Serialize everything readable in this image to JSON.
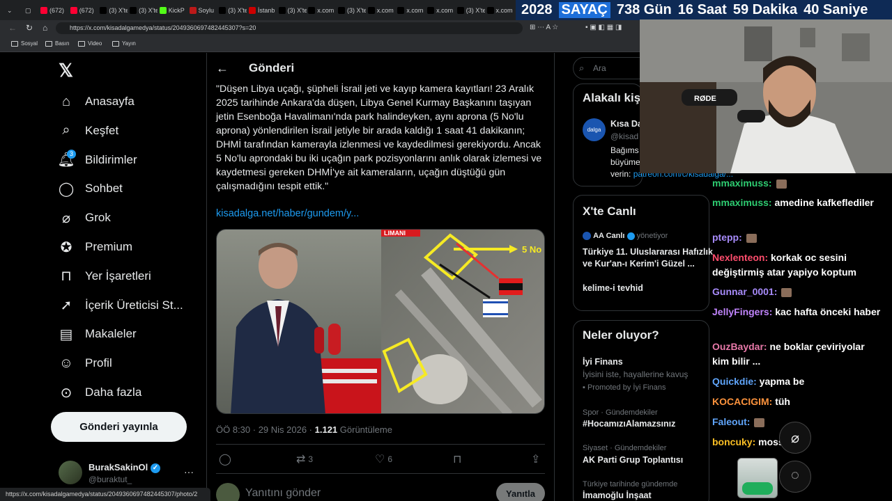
{
  "browser": {
    "tabs": [
      {
        "label": "(672)",
        "icon": "youtube-icon"
      },
      {
        "label": "(672)",
        "icon": "youtube-icon"
      },
      {
        "label": "(3) X'te",
        "icon": "x-icon"
      },
      {
        "label": "(3) X'te",
        "icon": "x-icon"
      },
      {
        "label": "KickP",
        "icon": "kick-icon"
      },
      {
        "label": "Soylu",
        "icon": "bbc-icon"
      },
      {
        "label": "(3) X'te",
        "icon": "x-icon"
      },
      {
        "label": "İstanb",
        "icon": "news-icon"
      },
      {
        "label": "(3) X'te",
        "icon": "x-icon"
      },
      {
        "label": "x.com",
        "icon": "x-icon"
      },
      {
        "label": "(3) X'te",
        "icon": "x-icon"
      },
      {
        "label": "x.com",
        "icon": "x-icon"
      },
      {
        "label": "x.com",
        "icon": "x-icon"
      },
      {
        "label": "x.com",
        "icon": "x-icon"
      },
      {
        "label": "(3) X'te",
        "icon": "x-icon"
      },
      {
        "label": "x.com",
        "icon": "x-icon"
      }
    ],
    "url": "https://x.com/kisadalgamedya/status/2049360697482445307?s=20",
    "bookmarks": [
      "Sosyal",
      "Basın",
      "Video",
      "Yayın"
    ],
    "status_url": "https://x.com/kisadalgamedya/status/2049360697482445307/photo/2"
  },
  "counter": {
    "year": "2028",
    "label": "SAYAÇ",
    "days": "738 Gün",
    "hours": "16 Saat",
    "minutes": "59 Dakika",
    "seconds": "40 Saniye"
  },
  "sidebar": {
    "items": [
      {
        "label": "Anasayfa",
        "icon": "home-icon"
      },
      {
        "label": "Keşfet",
        "icon": "search-icon"
      },
      {
        "label": "Bildirimler",
        "icon": "bell-icon",
        "badge": "3"
      },
      {
        "label": "Sohbet",
        "icon": "chat-icon"
      },
      {
        "label": "Grok",
        "icon": "grok-icon"
      },
      {
        "label": "Premium",
        "icon": "premium-icon"
      },
      {
        "label": "Yer İşaretleri",
        "icon": "bookmark-icon"
      },
      {
        "label": "İçerik Üreticisi St...",
        "icon": "rocket-icon"
      },
      {
        "label": "Makaleler",
        "icon": "article-icon"
      },
      {
        "label": "Profil",
        "icon": "profile-icon"
      },
      {
        "label": "Daha fazla",
        "icon": "more-icon"
      }
    ],
    "post_button": "Gönderi yayınla",
    "account": {
      "name": "BurakSakinOl",
      "handle": "@buraktut_"
    }
  },
  "main": {
    "header": "Gönderi",
    "tweet_text": "\"Düşen Libya uçağı, şüpheli İsrail jeti ve kayıp kamera kayıtları! 23 Aralık 2025 tarihinde Ankara'da düşen, Libya Genel Kurmay Başkanını taşıyan jetin Esenboğa Havalimanı'nda park halindeyken, aynı aprona (5 No'lu aprona) yönlendirilen İsrail jetiyle bir arada kaldığı 1 saat 41 dakikanın; DHMİ tarafından kamerayla izlenmesi ve kaydedilmesi gerekiyordu. Ancak 5 No'lu aprondaki bu iki uçağın park pozisyonlarını anlık olarak izlemesi ve kaydetmesi gereken DHMİ'ye ait kameraların, uçağın düştüğü gün çalışmadığını tespit ettik.\"",
    "link": "kisadalga.net/haber/gundem/y...",
    "image_labels": {
      "apron": "LIMANI",
      "apron_no": "5 No"
    },
    "time": "ÖÖ 8:30 · 29 Nis 2026 · ",
    "views_count": "1.121",
    "views_label": " Görüntüleme",
    "actions": {
      "reply": "",
      "repost": "3",
      "like": "6"
    },
    "reply_placeholder": "Yanıtını gönder",
    "reply_button": "Yanıtla"
  },
  "right": {
    "search_placeholder": "Ara",
    "related_title": "Alakalı kiş",
    "related_name": "Kısa Da",
    "related_handle": "@kisad",
    "related_bio1": "Bağıms",
    "related_bio2": "büyüme",
    "related_bio3": "verin:",
    "related_link": "patreon.com/c/kisadalga/...",
    "live_title": "X'te Canlı",
    "live_host": "AA Canlı",
    "live_status": "yönetiyor",
    "live_desc": "Türkiye 11. Uluslararası Hafızlık ve Kur'an-ı Kerim'i Güzel ...",
    "live_item2": "kelime-i tevhid",
    "happening_title": "Neler oluyor?",
    "ad_title": "İyi Finans",
    "ad_desc": "İyisini iste, hayallerine kavuş",
    "ad_promo": "Promoted by İyi Finans",
    "trends": [
      {
        "cat": "Spor · Gündemdekiler",
        "name": "#HocamızıAlamazsınız"
      },
      {
        "cat": "Siyaset · Gündemdekiler",
        "name": "AK Parti Grup Toplantısı"
      },
      {
        "cat": "Türkiye tarihinde gündemde",
        "name": "İmamoğlu İnşaat"
      }
    ]
  },
  "chat": {
    "messages": [
      {
        "user": "mmaximuss:",
        "text": "",
        "color": "#2ecc71"
      },
      {
        "user": "mmaximuss:",
        "text": " amedine kafkeflediler",
        "color": "#2ecc71"
      },
      {
        "user": "ptepp:",
        "text": "",
        "color": "#a78bfa"
      },
      {
        "user": "Nexlenteon:",
        "text": " korkak oc sesini değiştirmiş atar yapiyo koptum",
        "color": "#ff4d6d"
      },
      {
        "user": "Gunnar_0001:",
        "text": "",
        "color": "#a78bfa"
      },
      {
        "user": "JellyFingers:",
        "text": " kac hafta önceki haber",
        "color": "#c084fc"
      },
      {
        "user": "OuzBaydar:",
        "text": " ne boklar çeviriyolar kim bilir ...",
        "color": "#e879a9"
      },
      {
        "user": "Quickdie:",
        "text": " yapma be",
        "color": "#60a5fa"
      },
      {
        "user": "KOCACIGIM:",
        "text": " tüh",
        "color": "#fb923c"
      },
      {
        "user": "Faleout:",
        "text": "",
        "color": "#60a5fa"
      },
      {
        "user": "boncuky:",
        "text": " mossad",
        "color": "#fbbf24"
      }
    ]
  },
  "colors": {
    "x_blue": "#1d9bf0",
    "background": "#000000",
    "border": "#2f3336",
    "counter_bg": "#0e2a55"
  }
}
